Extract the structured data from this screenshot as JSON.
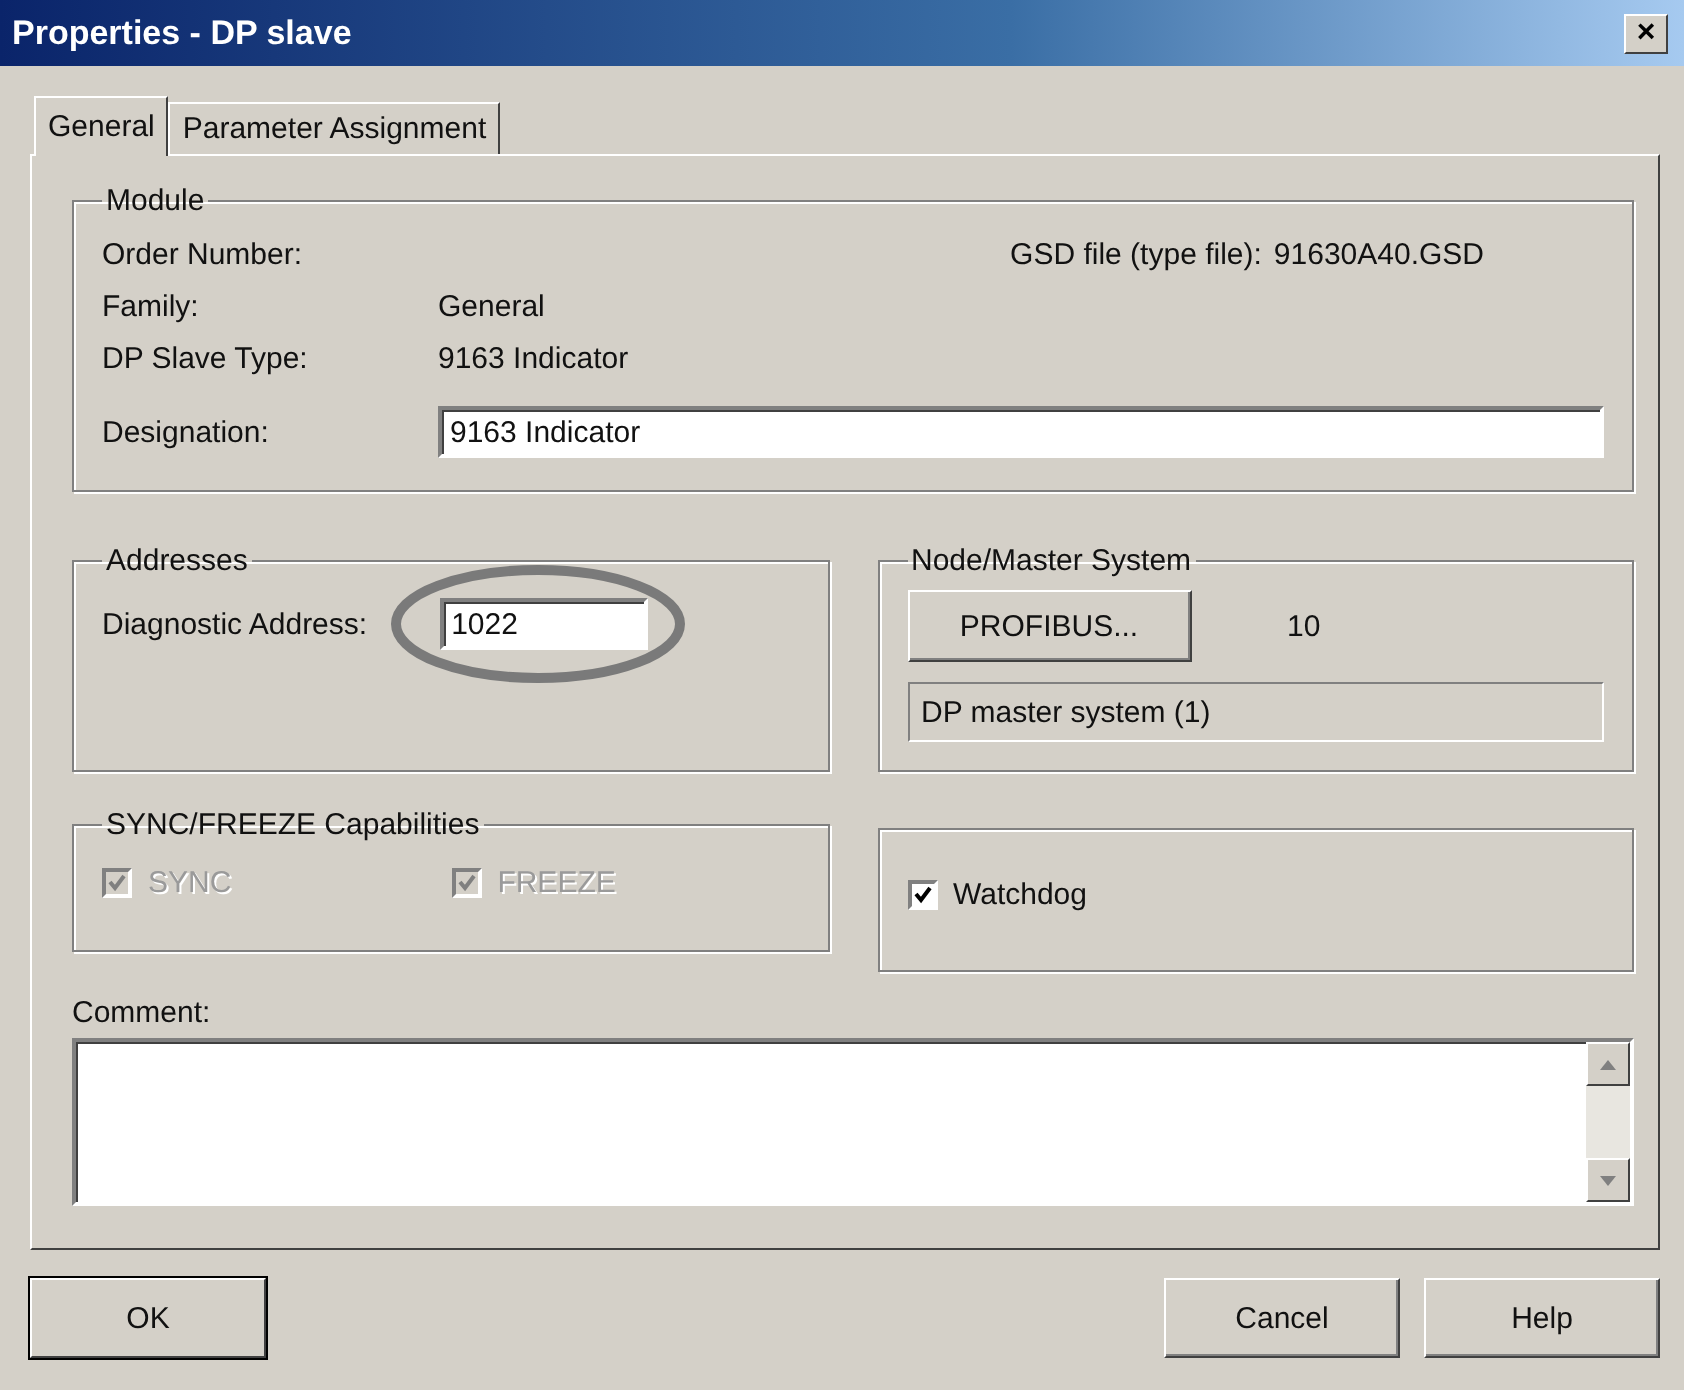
{
  "window": {
    "title": "Properties - DP slave",
    "close": "×"
  },
  "tabs": [
    {
      "label": "General",
      "selected": true
    },
    {
      "label": "Parameter Assignment",
      "selected": false
    }
  ],
  "module": {
    "title": "Module",
    "order_number_label": "Order Number:",
    "gsd_label": "GSD file (type file):",
    "gsd_value": "91630A40.GSD",
    "family_label": "Family:",
    "family_value": "General",
    "slave_type_label": "DP Slave Type:",
    "slave_type_value": "9163 Indicator",
    "designation_label": "Designation:",
    "designation_value": "9163 Indicator"
  },
  "addresses": {
    "title": "Addresses",
    "diagnostic_label": "Diagnostic Address:",
    "diagnostic_value": "1022",
    "highlighted": true
  },
  "node": {
    "title": "Node/Master System",
    "button": "PROFIBUS...",
    "address": "10",
    "master_system": "DP master system (1)"
  },
  "sync_freeze": {
    "title": "SYNC/FREEZE Capabilities",
    "options": [
      {
        "label": "SYNC",
        "checked": true,
        "disabled": true
      },
      {
        "label": "FREEZE",
        "checked": true,
        "disabled": true
      }
    ]
  },
  "watchdog": {
    "label": "Watchdog",
    "checked": true,
    "disabled": false
  },
  "comment": {
    "label": "Comment:"
  },
  "buttons": [
    {
      "label": "OK",
      "default": true
    },
    {
      "label": "Cancel",
      "default": false
    },
    {
      "label": "Help",
      "default": false
    }
  ]
}
